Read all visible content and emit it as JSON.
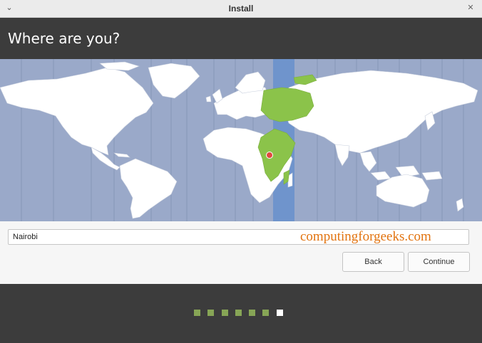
{
  "window": {
    "title": "Install",
    "menu_icon": "chevron-down-icon",
    "close_icon": "close-icon"
  },
  "header": {
    "title": "Where are you?"
  },
  "map": {
    "ocean_color": "#9aa9c9",
    "land_color": "#ffffff",
    "highlight_color": "#8bc34a",
    "timezone_band_color": "#6f94cc",
    "marker_color": "#e04a3f",
    "selected_location": "Nairobi"
  },
  "location": {
    "value": "Nairobi",
    "watermark": "computingforgeeks.com"
  },
  "buttons": {
    "back": "Back",
    "continue": "Continue"
  },
  "progress": {
    "total_steps": 7,
    "current_step": 7,
    "done_color": "#87a556",
    "current_color": "#ffffff"
  }
}
